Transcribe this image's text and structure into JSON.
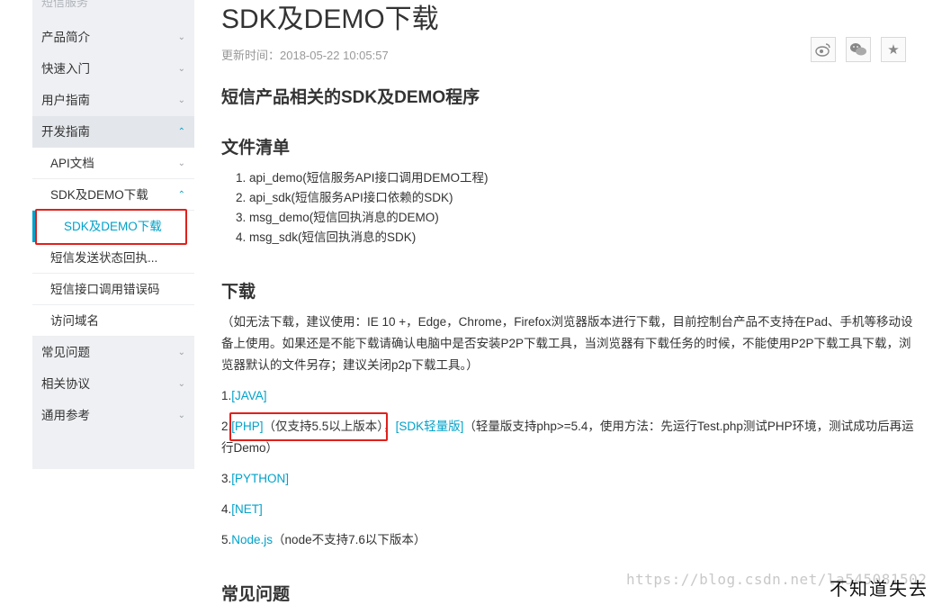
{
  "sidebar": {
    "header": "短信服务",
    "items": [
      {
        "label": "产品简介",
        "chevron": "chevron-down-icon"
      },
      {
        "label": "快速入门",
        "chevron": "chevron-down-icon"
      },
      {
        "label": "用户指南",
        "chevron": "chevron-down-icon"
      },
      {
        "label": "开发指南",
        "chevron": "chevron-up-icon"
      },
      {
        "label": "API文档",
        "chevron": "chevron-down-icon"
      },
      {
        "label": "SDK及DEMO下载",
        "chevron": "chevron-up-icon"
      },
      {
        "label": "SDK及DEMO下载"
      },
      {
        "label": "短信发送状态回执..."
      },
      {
        "label": "短信接口调用错误码"
      },
      {
        "label": "访问域名"
      },
      {
        "label": "常见问题",
        "chevron": "chevron-down-icon"
      },
      {
        "label": "相关协议",
        "chevron": "chevron-down-icon"
      },
      {
        "label": "通用参考",
        "chevron": "chevron-down-icon"
      }
    ]
  },
  "main": {
    "title": "SDK及DEMO下载",
    "updated": "更新时间：2018-05-22 10:05:57",
    "share_icons": [
      "weibo-icon",
      "wechat-icon",
      "star-icon"
    ],
    "section1": "短信产品相关的SDK及DEMO程序",
    "section2": "文件清单",
    "files": [
      "1. api_demo(短信服务API接口调用DEMO工程)",
      "2. api_sdk(短信服务API接口依赖的SDK)",
      "3. msg_demo(短信回执消息的DEMO)",
      "4. msg_sdk(短信回执消息的SDK)"
    ],
    "section3": "下载",
    "download_note": "（如无法下载，建议使用：IE 10 +，Edge，Chrome，Firefox浏览器版本进行下载，目前控制台产品不支持在Pad、手机等移动设备上使用。如果还是不能下载请确认电脑中是否安装P2P下载工具，当浏览器有下载任务的时候，不能使用P2P下载工具下载，浏览器默认的文件另存；建议关闭p2p下载工具。）",
    "downloads": {
      "java": {
        "num": "1.",
        "link": "[JAVA]"
      },
      "php": {
        "num": "2.",
        "link": "[PHP]",
        "note": "（仅支持5.5以上版本）",
        "sep": "，",
        "link2": "[SDK轻量版]",
        "note2": "（轻量版支持php>=5.4，使用方法：先运行Test.php测试PHP环境，测试成功后再运行Demo）"
      },
      "python": {
        "num": "3.",
        "link": "[PYTHON]"
      },
      "net": {
        "num": "4.",
        "link": "[NET]"
      },
      "node": {
        "num": "5.",
        "link": "Node.js",
        "note": "（node不支持7.6以下版本）"
      }
    },
    "section4": "常见问题"
  },
  "watermark": "https://blog.csdn.net/la545081502",
  "watermark2": "不知道失去",
  "colors": {
    "accent": "#00a2ca",
    "highlight_box": "#e0201b",
    "sidebar_bg": "#eef0f3"
  }
}
